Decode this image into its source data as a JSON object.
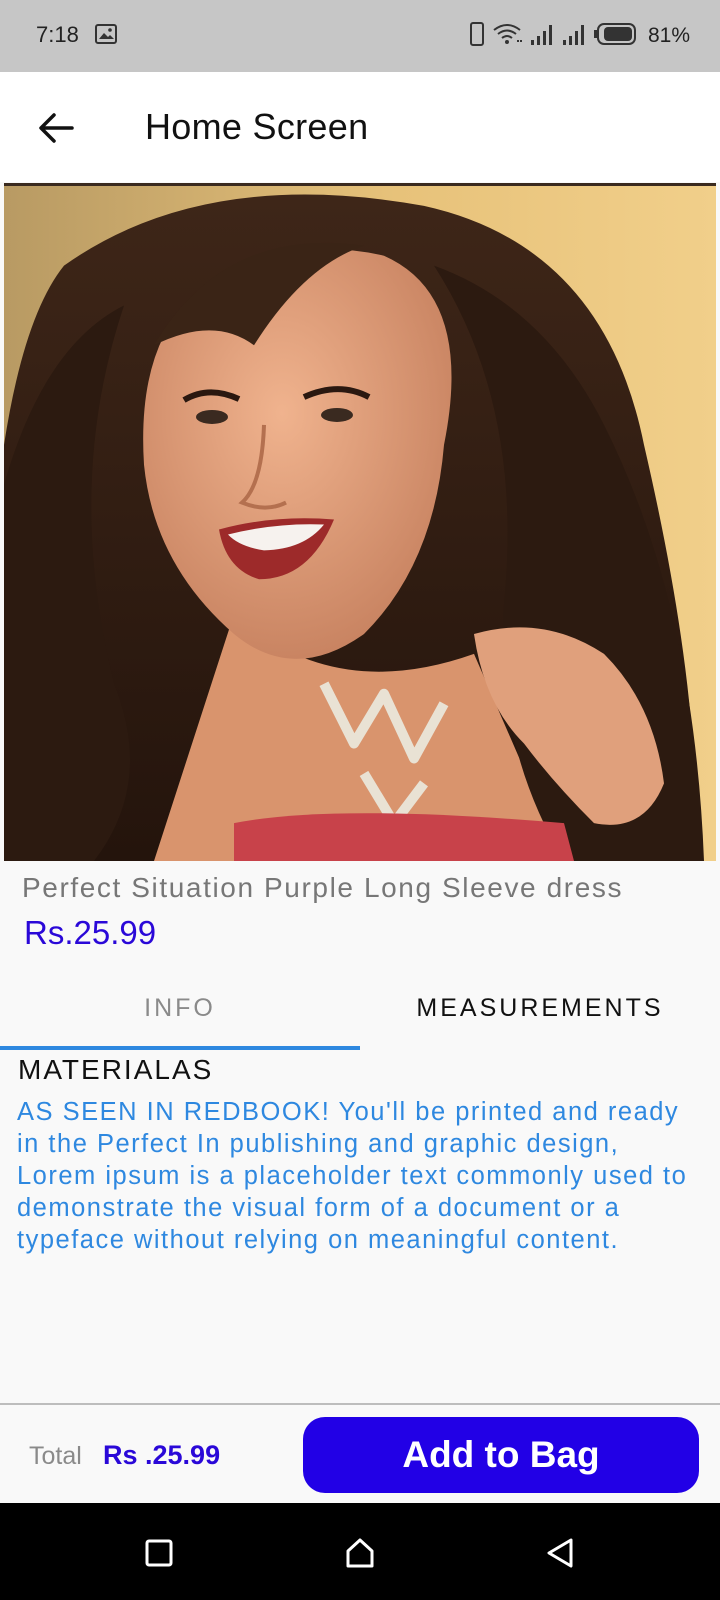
{
  "status_bar": {
    "time": "7:18",
    "battery_percent": "81%",
    "icons": [
      "image-icon",
      "vibrate-icon",
      "wifi-icon",
      "signal-icon",
      "signal-icon",
      "battery-icon"
    ]
  },
  "app_bar": {
    "title": "Home Screen",
    "back_icon": "arrow-left-icon"
  },
  "product": {
    "name": "Perfect Situation Purple Long Sleeve dress",
    "price": "Rs.25.99"
  },
  "tabs": [
    {
      "label": "INFO",
      "selected": true
    },
    {
      "label": "MEASUREMENTS",
      "selected": false
    }
  ],
  "details": {
    "heading": "MATERIALAS",
    "description": "AS SEEN IN REDBOOK! You'll be printed and ready in the Perfect In publishing and graphic design, Lorem ipsum is a placeholder text commonly used to demonstrate the visual form of a document or a typeface without relying on meaningful content."
  },
  "bottom_bar": {
    "total_label": "Total",
    "total_value": "Rs .25.99",
    "add_button_label": "Add to Bag"
  },
  "colors": {
    "accent_blue": "#2e88e0",
    "price_purple": "#2a08d8",
    "button_bg": "#2200e6",
    "status_bar_bg": "#c6c6c6"
  }
}
